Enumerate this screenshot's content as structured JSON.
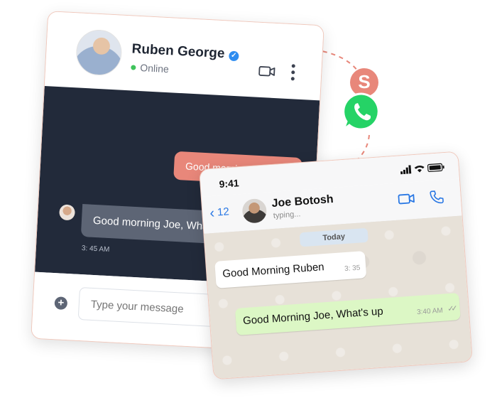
{
  "web_chat": {
    "contact_name": "Ruben George",
    "status": "Online",
    "outgoing_message": "Good morning",
    "incoming_message": "Good morning Joe, What's up",
    "incoming_time": "3: 45 AM",
    "input_placeholder": "Type your message",
    "icons": [
      "verified-icon",
      "video-icon",
      "more-vertical-icon",
      "plus-icon"
    ]
  },
  "connector": {
    "brand_letter": "S",
    "brand_color": "#e8877a",
    "whatsapp_color": "#25d366"
  },
  "whatsapp_chat": {
    "status_time": "9:41",
    "back_count": "12",
    "contact_name": "Joe Botosh",
    "typing_text": "typing...",
    "date_chip": "Today",
    "incoming_message": "Good Morning Ruben",
    "incoming_time": "3: 35",
    "outgoing_message": "Good Morning Joe, What's up",
    "outgoing_time": "3:40 AM",
    "read_ticks": "✓✓",
    "accent": "#2a78e4"
  }
}
